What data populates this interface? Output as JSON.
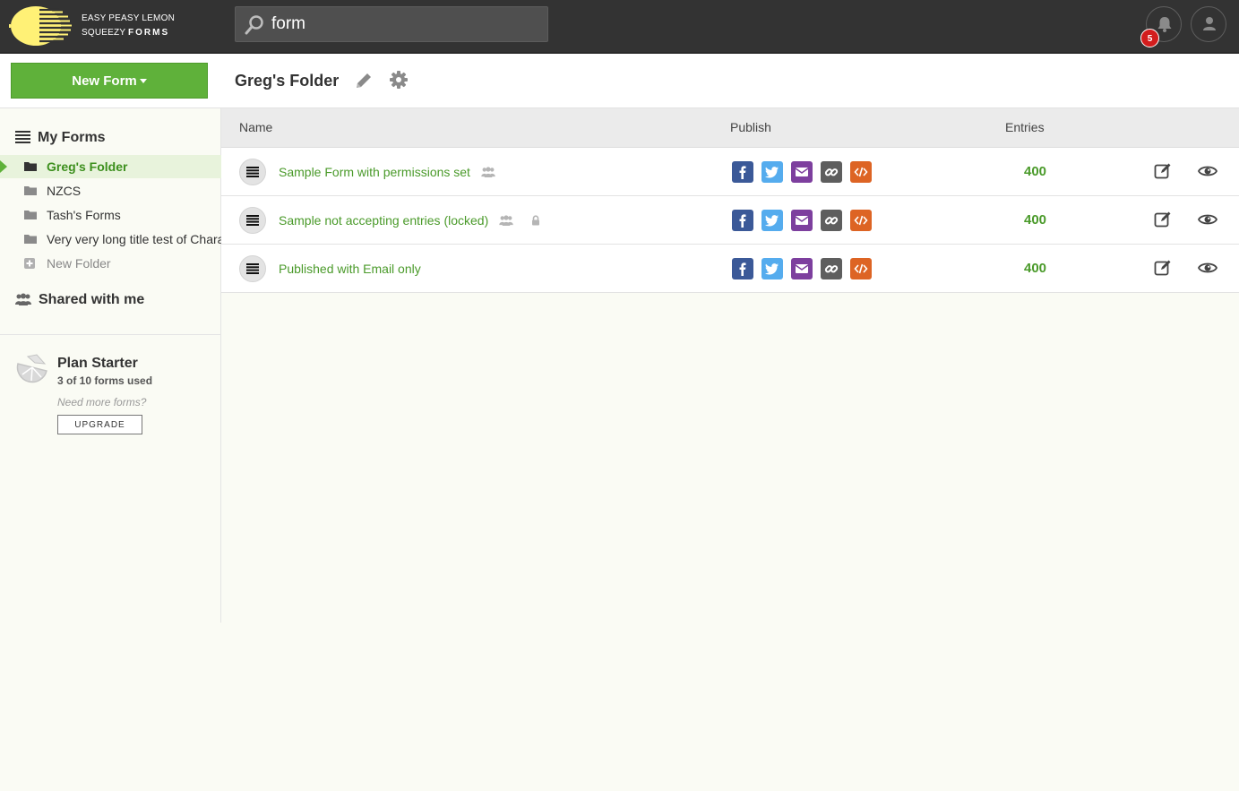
{
  "header": {
    "brand_line1": "EASY PEASY LEMON",
    "brand_line2a": "SQUEEZY",
    "brand_line2b": "FORMS",
    "search_value": "form",
    "notification_count": "5"
  },
  "toolbar": {
    "new_form_label": "New Form",
    "folder_title": "Greg's Folder"
  },
  "sidebar": {
    "my_forms_label": "My Forms",
    "folders": [
      {
        "label": "Greg's Folder",
        "active": true
      },
      {
        "label": "NZCS"
      },
      {
        "label": "Tash's Forms"
      },
      {
        "label": "Very very long title test of Characters"
      }
    ],
    "new_folder_label": "New Folder",
    "shared_label": "Shared with me",
    "plan": {
      "name": "Plan Starter",
      "usage": "3 of 10 forms used",
      "need_more": "Need more forms?",
      "upgrade_label": "UPGRADE"
    }
  },
  "table": {
    "columns": {
      "name": "Name",
      "publish": "Publish",
      "entries": "Entries"
    },
    "rows": [
      {
        "title": "Sample Form with permissions set",
        "shared": true,
        "locked": false,
        "entries": "400"
      },
      {
        "title": "Sample not accepting entries (locked)",
        "shared": true,
        "locked": true,
        "entries": "400"
      },
      {
        "title": "Published with Email only",
        "shared": false,
        "locked": false,
        "entries": "400"
      }
    ]
  },
  "colors": {
    "accent_green": "#5fb13a",
    "header_bg": "#333333",
    "facebook": "#3b5998",
    "twitter": "#55acee",
    "email": "#7d3f9e",
    "link": "#5e5e5e",
    "embed": "#dd6424",
    "badge_red": "#d21d1d"
  },
  "icons": {
    "header": [
      "lemon-logo-icon",
      "search-icon",
      "bell-icon",
      "user-icon"
    ],
    "toolbar": [
      "pencil-icon",
      "gear-icon"
    ],
    "row": [
      "form-list-icon",
      "users-icon",
      "lock-icon",
      "facebook-icon",
      "twitter-icon",
      "envelope-icon",
      "link-icon",
      "code-icon",
      "edit-icon",
      "eye-icon"
    ]
  }
}
